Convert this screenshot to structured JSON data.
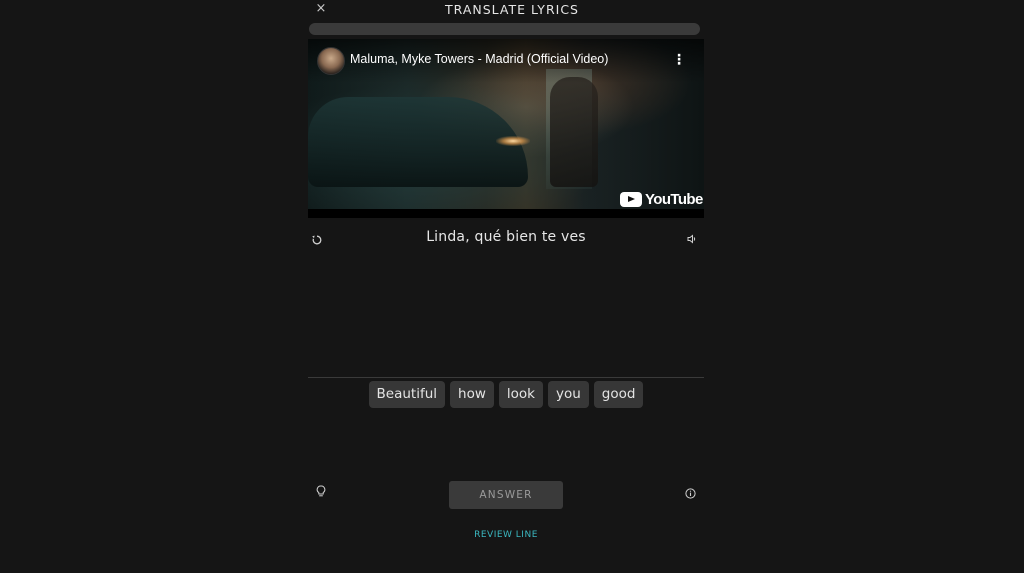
{
  "header": {
    "close_glyph": "×",
    "title": "TRANSLATE LYRICS",
    "progress": 0
  },
  "video": {
    "title": "Maluma, Myke Towers - Madrid (Official Video)",
    "menu_glyph": "⋮",
    "brand": "YouTube"
  },
  "lyric": {
    "line": "Linda, qué bien te ves"
  },
  "word_bank": [
    {
      "label": "Beautiful"
    },
    {
      "label": "how"
    },
    {
      "label": "look"
    },
    {
      "label": "you"
    },
    {
      "label": "good"
    }
  ],
  "footer": {
    "answer_label": "ANSWER",
    "review_label": "REVIEW LINE"
  },
  "icons": {
    "replay": "replay-icon",
    "speaker": "speaker-icon",
    "hint": "lightbulb-icon",
    "info": "info-icon"
  },
  "colors": {
    "background": "#151515",
    "chip": "#373737",
    "accent": "#3bb7c0"
  }
}
